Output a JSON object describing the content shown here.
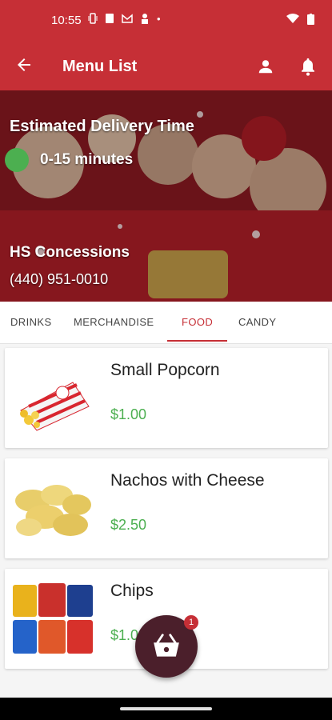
{
  "status_bar": {
    "time": "10:55",
    "dot": "•"
  },
  "app_bar": {
    "title": "Menu List",
    "back_icon": "arrow-left-icon",
    "user_icon": "user-icon",
    "bell_icon": "bell-icon"
  },
  "hero": {
    "delivery_label": "Estimated Delivery Time",
    "delivery_time": "0-15 minutes",
    "status_color": "#4caf50",
    "venue_name": "HS Concessions",
    "venue_phone": "(440) 951-0010"
  },
  "tabs": [
    {
      "label": "DRINKS"
    },
    {
      "label": "MERCHANDISE"
    },
    {
      "label": "FOOD",
      "active": true
    },
    {
      "label": "CANDY"
    }
  ],
  "menu_items": [
    {
      "name": "Small Popcorn",
      "price": "$1.00"
    },
    {
      "name": "Nachos with Cheese",
      "price": "$2.50"
    },
    {
      "name": "Chips",
      "price": "$1.00"
    }
  ],
  "cart": {
    "count": "1",
    "icon": "basket-icon"
  },
  "colors": {
    "brand": "#c62f36",
    "price": "#4caf50",
    "fab": "#4b1f2b"
  }
}
